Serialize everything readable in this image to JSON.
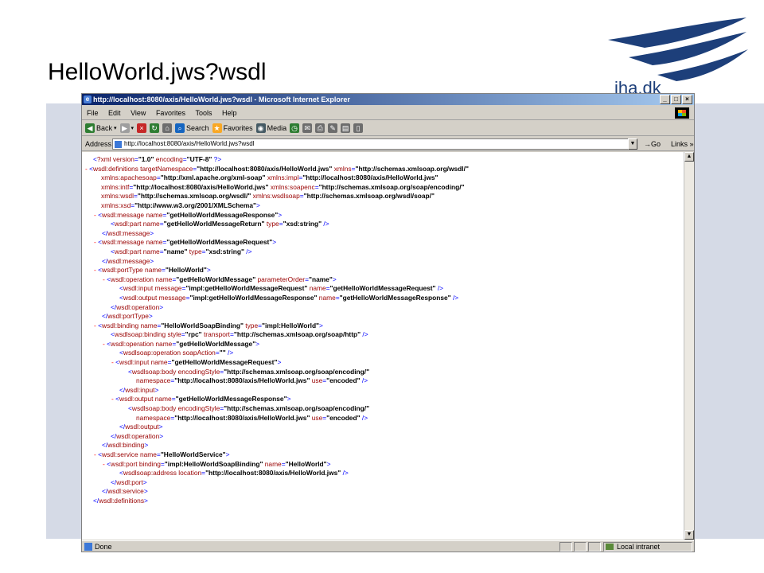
{
  "slide": {
    "title": "HelloWorld.jws?wsdl",
    "logo_text": "iha.dk"
  },
  "window": {
    "title": "http://localhost:8080/axis/HelloWorld.jws?wsdl - Microsoft Internet Explorer",
    "controls": [
      "_",
      "□",
      "×"
    ]
  },
  "menu": [
    "File",
    "Edit",
    "View",
    "Favorites",
    "Tools",
    "Help"
  ],
  "toolbar": {
    "back": "Back",
    "search": "Search",
    "favorites": "Favorites",
    "media": "Media"
  },
  "address": {
    "label": "Address",
    "url": "http://localhost:8080/axis/HelloWorld.jws?wsdl",
    "go": "Go",
    "links": "Links"
  },
  "xml_lines": [
    "<?xml version=\"1.0\" encoding=\"UTF-8\" ?>",
    "- <wsdl:definitions targetNamespace=\"http://localhost:8080/axis/HelloWorld.jws\" xmlns=\"http://schemas.xmlsoap.org/wsdl/\"",
    "xmlns:apachesoap=\"http://xml.apache.org/xml-soap\" xmlns:impl=\"http://localhost:8080/axis/HelloWorld.jws\"",
    "xmlns:intf=\"http://localhost:8080/axis/HelloWorld.jws\" xmlns:soapenc=\"http://schemas.xmlsoap.org/soap/encoding/\"",
    "xmlns:wsdl=\"http://schemas.xmlsoap.org/wsdl/\" xmlns:wsdlsoap=\"http://schemas.xmlsoap.org/wsdl/soap/\"",
    "xmlns:xsd=\"http://www.w3.org/2001/XMLSchema\">",
    "- <wsdl:message name=\"getHelloWorldMessageResponse\">",
    "<wsdl:part name=\"getHelloWorldMessageReturn\" type=\"xsd:string\" />",
    "</wsdl:message>",
    "- <wsdl:message name=\"getHelloWorldMessageRequest\">",
    "<wsdl:part name=\"name\" type=\"xsd:string\" />",
    "</wsdl:message>",
    "- <wsdl:portType name=\"HelloWorld\">",
    "- <wsdl:operation name=\"getHelloWorldMessage\" parameterOrder=\"name\">",
    "<wsdl:input message=\"impl:getHelloWorldMessageRequest\" name=\"getHelloWorldMessageRequest\" />",
    "<wsdl:output message=\"impl:getHelloWorldMessageResponse\" name=\"getHelloWorldMessageResponse\" />",
    "</wsdl:operation>",
    "</wsdl:portType>",
    "- <wsdl:binding name=\"HelloWorldSoapBinding\" type=\"impl:HelloWorld\">",
    "<wsdlsoap:binding style=\"rpc\" transport=\"http://schemas.xmlsoap.org/soap/http\" />",
    "- <wsdl:operation name=\"getHelloWorldMessage\">",
    "<wsdlsoap:operation soapAction=\"\" />",
    "- <wsdl:input name=\"getHelloWorldMessageRequest\">",
    "<wsdlsoap:body encodingStyle=\"http://schemas.xmlsoap.org/soap/encoding/\"",
    "namespace=\"http://localhost:8080/axis/HelloWorld.jws\" use=\"encoded\" />",
    "</wsdl:input>",
    "- <wsdl:output name=\"getHelloWorldMessageResponse\">",
    "<wsdlsoap:body encodingStyle=\"http://schemas.xmlsoap.org/soap/encoding/\"",
    "namespace=\"http://localhost:8080/axis/HelloWorld.jws\" use=\"encoded\" />",
    "</wsdl:output>",
    "</wsdl:operation>",
    "</wsdl:binding>",
    "- <wsdl:service name=\"HelloWorldService\">",
    "- <wsdl:port binding=\"impl:HelloWorldSoapBinding\" name=\"HelloWorld\">",
    "<wsdlsoap:address location=\"http://localhost:8080/axis/HelloWorld.jws\" />",
    "</wsdl:port>",
    "</wsdl:service>",
    "</wsdl:definitions>"
  ],
  "status": {
    "text": "Done",
    "zone": "Local intranet"
  },
  "colors": {
    "logo_blue": "#1d3f7a",
    "band": "#d5dae6",
    "titlebar": "#0a246a",
    "xml_markup": "#0000ff",
    "xml_attr_name": "#990000",
    "xml_collapse": "#ff0000"
  }
}
